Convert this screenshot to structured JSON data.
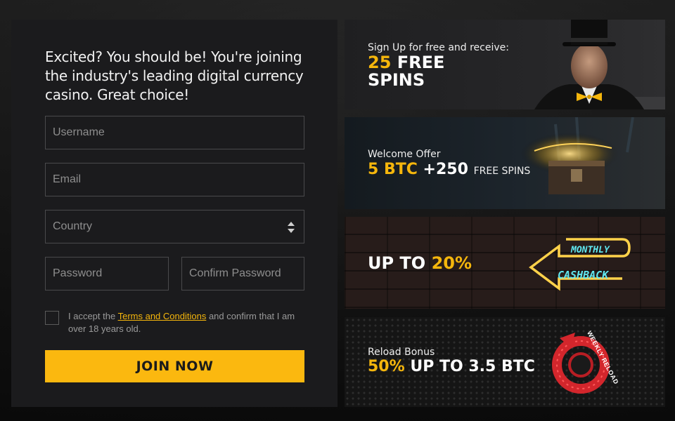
{
  "signup": {
    "intro_text": "Excited? You should be! You're joining the industry's leading digital currency casino. Great choice!",
    "username_placeholder": "Username",
    "email_placeholder": "Email",
    "country_placeholder": "Country",
    "password_placeholder": "Password",
    "confirm_password_placeholder": "Confirm Password",
    "terms_prefix": "I accept the ",
    "terms_link": "Terms and Conditions",
    "terms_suffix": " and confirm that I am over 18 years old.",
    "join_label": "JOIN NOW",
    "accent_color": "#fbb80f"
  },
  "promos": [
    {
      "line1": "Sign Up for free and receive:",
      "highlight": "25",
      "line2_rest": " FREE",
      "line3": "SPINS"
    },
    {
      "line1": "Welcome Offer",
      "highlight": "5 BTC",
      "bonus": " +250 ",
      "free_spins": "FREE SPINS"
    },
    {
      "line1_prefix": "UP TO ",
      "highlight": "20%",
      "neon_top": "MONTHLY",
      "neon_bottom": "CASHBACK"
    },
    {
      "line1": "Reload Bonus",
      "highlight": "50%",
      "line2_rest": " UP TO 3.5 BTC",
      "badge": "WEEKLY RELOAD"
    }
  ]
}
